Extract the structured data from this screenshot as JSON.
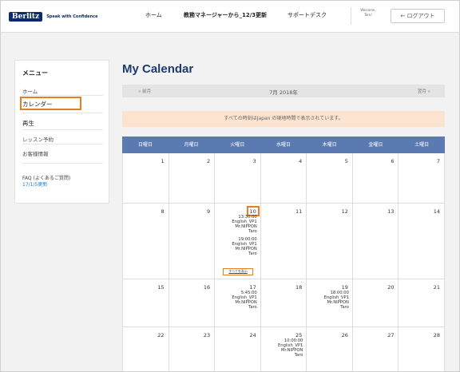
{
  "header": {
    "logo_text": "Berlitz",
    "logo_tagline": "Speak with Confidence",
    "nav": [
      "ホーム",
      "教務マネージャーから_12/3更新",
      "サポートデスク"
    ],
    "welcome_line1": "Welcome,",
    "welcome_line2": "Taro!",
    "logout_label": "← ログアウト"
  },
  "sidebar": {
    "title": "メニュー",
    "items": [
      "ホーム",
      "カレンダー",
      "再生",
      "レッスン予約",
      "お客様情報"
    ],
    "faq_label": "FAQ (よくあるご質問)",
    "faq_update": "17/1/5更新"
  },
  "main": {
    "title": "My Calendar",
    "prev_label": "« 前月",
    "next_label": "翌月 »",
    "month_label": "7月 2018年",
    "notice": "すべての時刻はJapan の現地時間で表示されています。",
    "weekdays": [
      "日曜日",
      "月曜日",
      "火曜日",
      "水曜日",
      "木曜日",
      "金曜日",
      "土曜日"
    ],
    "show_all_label": "すべてを表示",
    "weeks": [
      [
        {
          "day": "1"
        },
        {
          "day": "2"
        },
        {
          "day": "3"
        },
        {
          "day": "4"
        },
        {
          "day": "5"
        },
        {
          "day": "6"
        },
        {
          "day": "7"
        }
      ],
      [
        {
          "day": "8"
        },
        {
          "day": "9"
        },
        {
          "day": "10",
          "highlighted": true,
          "show_all": true,
          "events": [
            {
              "time": "13:30:00",
              "course": "English_VP1",
              "teacher": "Mr.NIPPON",
              "student": "Taro"
            },
            {
              "time": "19:00:00",
              "course": "English_VP1",
              "teacher": "Mr.NIPPON",
              "student": "Taro"
            }
          ]
        },
        {
          "day": "11"
        },
        {
          "day": "12"
        },
        {
          "day": "13"
        },
        {
          "day": "14"
        }
      ],
      [
        {
          "day": "15"
        },
        {
          "day": "16"
        },
        {
          "day": "17",
          "events": [
            {
              "time": "5:45:00",
              "course": "English_VP1",
              "teacher": "Mr.NIPPON",
              "student": "Taro"
            }
          ]
        },
        {
          "day": "18"
        },
        {
          "day": "19",
          "events": [
            {
              "time": "18:00:00",
              "course": "English_VP1",
              "teacher": "Mr.NIPPON",
              "student": "Taro"
            }
          ]
        },
        {
          "day": "20"
        },
        {
          "day": "21"
        }
      ],
      [
        {
          "day": "22"
        },
        {
          "day": "23"
        },
        {
          "day": "24"
        },
        {
          "day": "25",
          "events": [
            {
              "time": "10:00:00",
              "course": "English_VP1",
              "teacher": "Mr.NIPPON",
              "student": "Taro"
            }
          ]
        },
        {
          "day": "26"
        },
        {
          "day": "27"
        },
        {
          "day": "28"
        }
      ]
    ]
  },
  "colors": {
    "accent_highlight": "#e67e22",
    "header_blue": "#5b7ab1",
    "title_navy": "#1e3a6e",
    "notice_bg": "#fbe3cf"
  }
}
